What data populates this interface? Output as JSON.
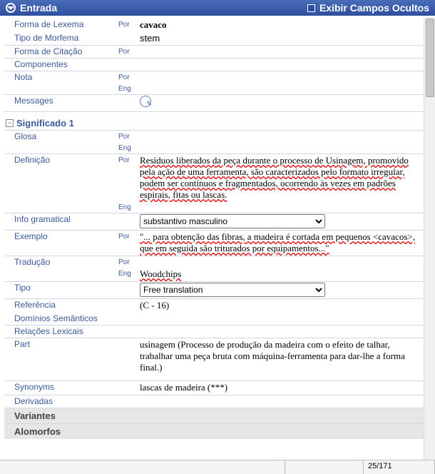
{
  "header": {
    "title": "Entrada",
    "hiddenFields": "Exibir Campos Ocultos"
  },
  "lang": {
    "por": "Por",
    "eng": "Eng"
  },
  "labels": {
    "formaLexema": "Forma de Lexema",
    "tipoMorfema": "Tipo de Morfema",
    "formaCitacao": "Forma de Citação",
    "componentes": "Componentes",
    "nota": "Nota",
    "messages": "Messages",
    "significado": "Significado 1",
    "glosa": "Glosa",
    "definicao": "Definição",
    "infoGramatical": "Info gramatical",
    "exemplo": "Exemplo",
    "traducao": "Tradução",
    "tipo": "Tipo",
    "referencia": "Referência",
    "dominios": "Domínios Semânticos",
    "relacoes": "Relações Lexicais",
    "part": "Part",
    "synonyms": "Synonyms",
    "derivadas": "Derivadas",
    "variantes": "Variantes",
    "alomorfos": "Alomorfos"
  },
  "values": {
    "lexema": "cavaco",
    "tipoMorfema": "stem",
    "definicao": "Resíduos liberados da peça durante o processo de Usinagem, promovido pela ação de uma ferramenta, são caracterizados pelo formato irregular, podem ser contínuos e fragmentados, ocorrendo às vezes em padrões espirais, fitas ou lascas.",
    "infoGramatical": "substantivo masculino",
    "exemplo": "\"... para obtenção das fibras, a madeira é cortada em pequenos <cavacos>, que em seguida são triturados por equipamentos...\"",
    "traducaoEng": "Woodchips",
    "tipo": "Free translation",
    "referencia": "(C - 16)",
    "part": "usinagem (Processo de produção da madeira  com o efeito de talhar, trabalhar uma peça bruta com máquina-ferramenta para dar-lhe a forma final.)",
    "synonyms": "lascas de madeira (***)"
  },
  "status": {
    "page": "25/171"
  }
}
